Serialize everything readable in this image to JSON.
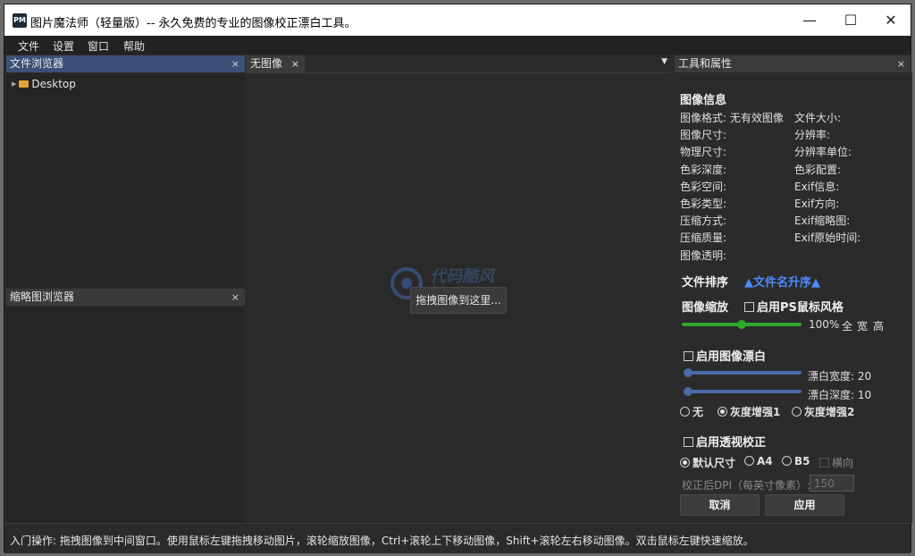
{
  "window": {
    "title": "图片魔法师（轻量版）-- 永久免费的专业的图像校正漂白工具。",
    "app_icon": "PM",
    "minimize": "—",
    "maximize": "☐",
    "close": "✕"
  },
  "menu": [
    "文件",
    "设置",
    "窗口",
    "帮助"
  ],
  "file_browser": {
    "title": "文件浏览器",
    "close": "×",
    "tree_item": "Desktop",
    "tree_arrow": "▶"
  },
  "thumb_browser": {
    "title": "缩略图浏览器",
    "close": "×"
  },
  "tabs": {
    "active_label": "无图像",
    "close": "×",
    "dropdown": "▼"
  },
  "canvas": {
    "drop_hint": "拖拽图像到这里...",
    "watermark_text": "代码酷风",
    "watermark_sub": "daimakushop"
  },
  "properties": {
    "title": "工具和属性",
    "close": "×",
    "image_info_title": "图像信息",
    "info_left": [
      "图像格式: 无有效图像",
      "图像尺寸:",
      "物理尺寸:",
      "色彩深度:",
      "色彩空间:",
      "色彩类型:",
      "压缩方式:",
      "压缩质量:",
      "图像透明:"
    ],
    "info_right": [
      "文件大小:",
      "分辨率:",
      "分辨率单位:",
      "色彩配置:",
      "Exif信息:",
      "Exif方向:",
      "Exif缩略图:",
      "Exif原始时间:"
    ],
    "sort_label": "文件排序",
    "sort_value": "▲文件名升序▲",
    "zoom_label": "图像缩放",
    "ps_mouse_label": "启用PS鼠标风格",
    "zoom_percent": "100%",
    "zoom_full": "全",
    "zoom_width": "宽",
    "zoom_height": "高",
    "zoom_level": 0.5,
    "whiten_enable": "启用图像漂白",
    "whiten_width_label": "漂白宽度: 20",
    "whiten_depth_label": "漂白深度: 10",
    "whiten_width_value": 20,
    "whiten_depth_value": 10,
    "mode_none": "无",
    "mode_gray1": "灰度增强1",
    "mode_gray2": "灰度增强2",
    "perspective_enable": "启用透视校正",
    "size_default": "默认尺寸",
    "size_a4": "A4",
    "size_b5": "B5",
    "landscape": "横向",
    "dpi_label": "校正后DPI（每英寸像素）:",
    "dpi_value": "150",
    "cancel": "取消",
    "apply": "应用"
  },
  "status": "入门操作: 拖拽图像到中间窗口。使用鼠标左键拖拽移动图片，滚轮缩放图像，Ctrl+滚轮上下移动图像，Shift+滚轮左右移动图像。双击鼠标左键快速缩放。",
  "colors": {
    "accent_blue": "#4a8cff",
    "zoom_slider": "#2ea82e",
    "whiten_slider": "#4a6aa8",
    "active_panel": "#3d4f78"
  }
}
